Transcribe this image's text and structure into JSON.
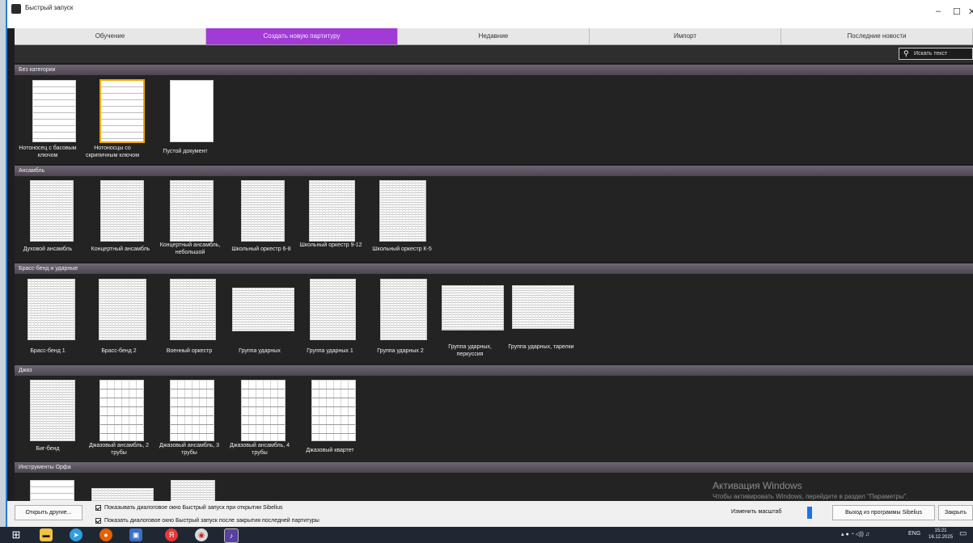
{
  "window": {
    "title": "Быстрый запуск"
  },
  "tabs": [
    {
      "label": "Обучение",
      "active": false
    },
    {
      "label": "Создать новую партитуру",
      "active": true
    },
    {
      "label": "Недавние",
      "active": false
    },
    {
      "label": "Импорт",
      "active": false
    },
    {
      "label": "Последние новости",
      "active": false
    }
  ],
  "search": {
    "placeholder": "Искать текст"
  },
  "categories": [
    {
      "title": "Без категории",
      "items": [
        {
          "label": "Нотоносец с басовым ключом"
        },
        {
          "label": "Нотоносцы со скрипичным ключом",
          "selected": true
        },
        {
          "label": "Пустой документ"
        }
      ]
    },
    {
      "title": "Ансамбль",
      "items": [
        {
          "label": "Духовой ансамбль"
        },
        {
          "label": "Концертный ансамбль"
        },
        {
          "label": "Концертный ансамбль, небольшой"
        },
        {
          "label": "Школьный оркестр 6-8"
        },
        {
          "label": "Школьный оркестр 9-12"
        },
        {
          "label": "Школьный оркестр К-5"
        }
      ]
    },
    {
      "title": "Брасс-бенд и ударные",
      "items": [
        {
          "label": "Брасс-бенд 1"
        },
        {
          "label": "Брасс-бенд 2"
        },
        {
          "label": "Военный оркестр"
        },
        {
          "label": "Группа ударных"
        },
        {
          "label": "Группа ударных 1"
        },
        {
          "label": "Группа ударных 2"
        },
        {
          "label": "Группа ударных, перкуссия"
        },
        {
          "label": "Группа ударных, тарелки"
        }
      ]
    },
    {
      "title": "Джаз",
      "items": [
        {
          "label": "Биг-бенд"
        },
        {
          "label": "Джазовый ансамбль, 2 трубы"
        },
        {
          "label": "Джазовый ансамбль, 3 трубы"
        },
        {
          "label": "Джазовый ансамбль, 4 трубы"
        },
        {
          "label": "Джазовый квартет"
        }
      ]
    },
    {
      "title": "Инструменты Орфа",
      "items": []
    }
  ],
  "watermark": {
    "line1": "Активация Windows",
    "line2": "Чтобы активировать Windows, перейдите в раздел \"Параметры\"."
  },
  "footer": {
    "open_other": "Открыть другие...",
    "check1": "Показывать диалоговое окно Быстрый запуск при открытии Sibelius",
    "check2": "Показать диалоговое окно Быстрый запуск после закрытия последней партитуры",
    "zoom_label": "Изменить масштаб",
    "exit": "Выход из программы Sibelius",
    "close": "Закрыть"
  },
  "taskbar": {
    "lang": "ENG",
    "time": "15:21",
    "date": "16.12.2025"
  }
}
